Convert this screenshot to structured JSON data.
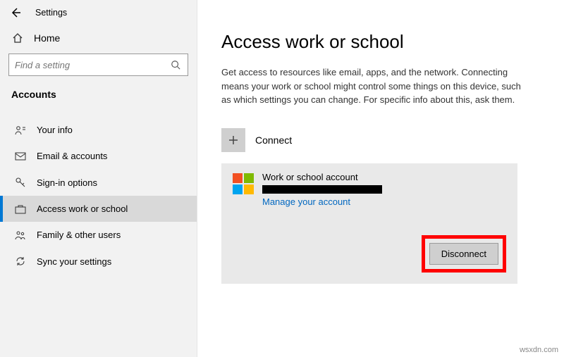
{
  "app": {
    "title": "Settings"
  },
  "sidebar": {
    "home": "Home",
    "search_placeholder": "Find a setting",
    "section": "Accounts",
    "items": [
      {
        "label": "Your info"
      },
      {
        "label": "Email & accounts"
      },
      {
        "label": "Sign-in options"
      },
      {
        "label": "Access work or school"
      },
      {
        "label": "Family & other users"
      },
      {
        "label": "Sync your settings"
      }
    ]
  },
  "main": {
    "title": "Access work or school",
    "description": "Get access to resources like email, apps, and the network. Connecting means your work or school might control some things on this device, such as which settings you can change. For specific info about this, ask them.",
    "connect_label": "Connect",
    "account": {
      "title": "Work or school account",
      "manage_link": "Manage your account",
      "disconnect_label": "Disconnect"
    }
  },
  "watermark": "wsxdn.com"
}
